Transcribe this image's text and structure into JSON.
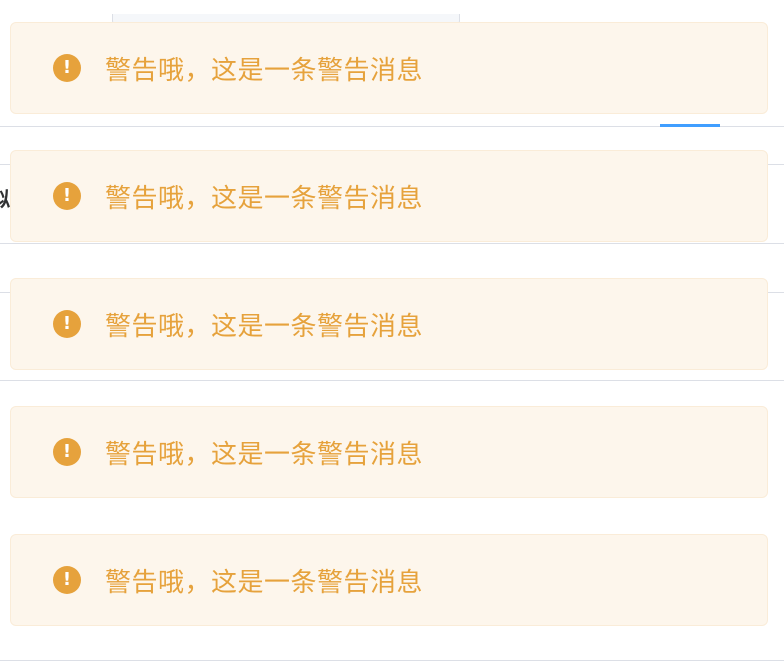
{
  "background": {
    "fragment_text": "拟"
  },
  "messages": [
    {
      "text": "警告哦，这是一条警告消息",
      "icon": "warning-icon",
      "type": "warning"
    },
    {
      "text": "警告哦，这是一条警告消息",
      "icon": "warning-icon",
      "type": "warning"
    },
    {
      "text": "警告哦，这是一条警告消息",
      "icon": "warning-icon",
      "type": "warning"
    },
    {
      "text": "警告哦，这是一条警告消息",
      "icon": "warning-icon",
      "type": "warning"
    },
    {
      "text": "警告哦，这是一条警告消息",
      "icon": "warning-icon",
      "type": "warning"
    }
  ],
  "icon_glyph": "!",
  "colors": {
    "warning_text": "#e6a23c",
    "warning_bg": "#fdf6ec",
    "warning_border": "#faecd8",
    "accent": "#409eff"
  }
}
